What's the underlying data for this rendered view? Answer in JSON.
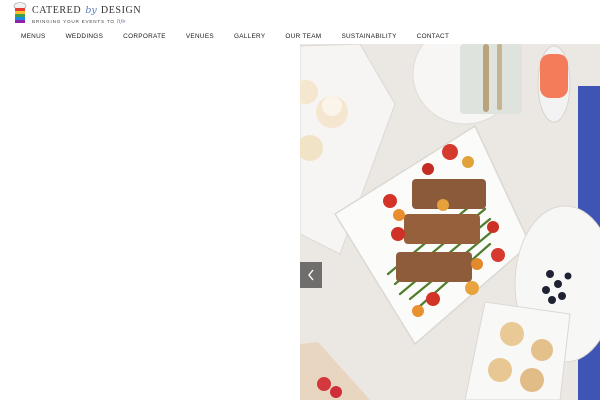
{
  "logo": {
    "name_part1": "CATERED",
    "name_by": "by",
    "name_part2": "DESIGN",
    "tagline": "BRINGING YOUR EVENTS TO",
    "tagline_script": "life"
  },
  "nav": {
    "items": [
      "MENUS",
      "WEDDINGS",
      "CORPORATE",
      "VENUES",
      "GALLERY",
      "OUR TEAM",
      "SUSTAINABILITY",
      "CONTACT"
    ]
  },
  "hero": {
    "prev_icon": "chevron-left-icon",
    "accent_color": "#3f55b5"
  }
}
